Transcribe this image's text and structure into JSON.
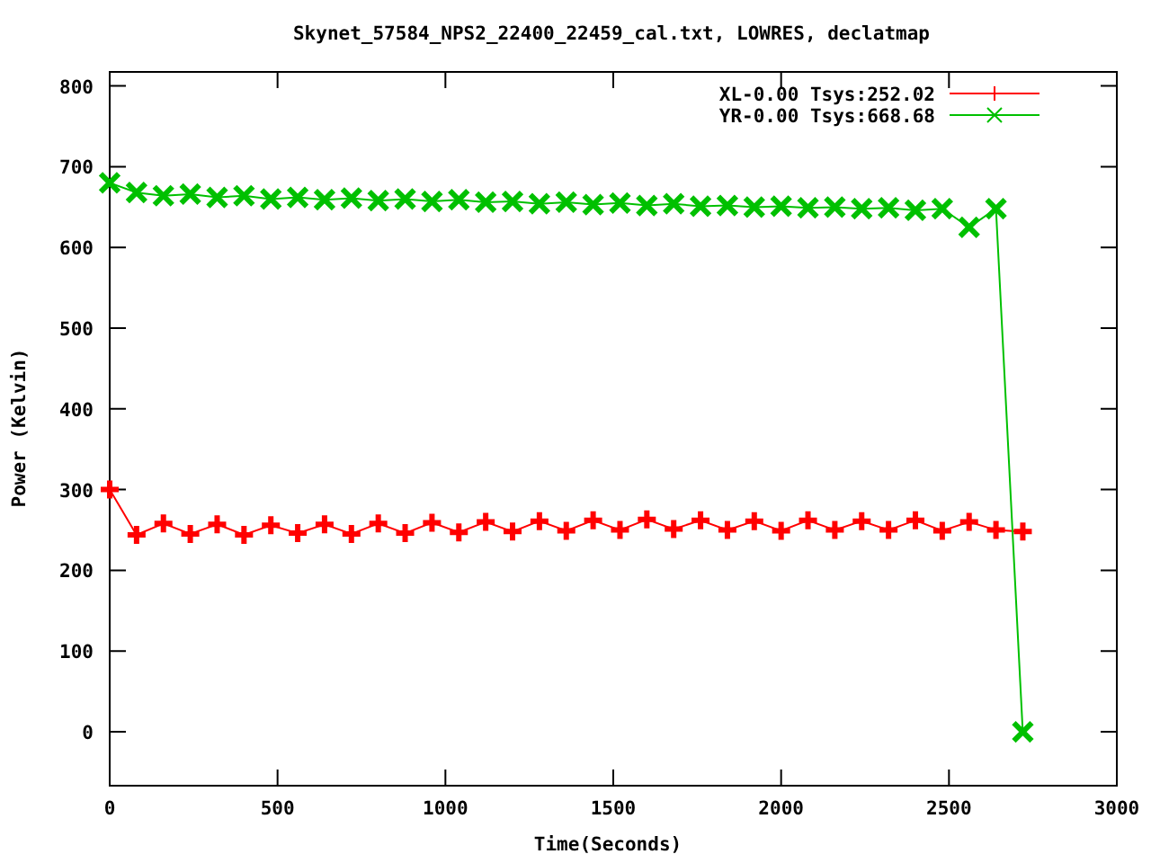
{
  "chart": {
    "chart_data": {
      "type": "line",
      "title": "Skynet_57584_NPS2_22400_22459_cal.txt, LOWRES, declatmap",
      "xlabel": "Time(Seconds)",
      "ylabel": "Power (Kelvin)",
      "x": [
        0,
        80,
        160,
        240,
        320,
        400,
        480,
        560,
        640,
        720,
        800,
        880,
        960,
        1040,
        1120,
        1200,
        1280,
        1360,
        1440,
        1520,
        1600,
        1680,
        1760,
        1840,
        1920,
        2000,
        2080,
        2160,
        2240,
        2320,
        2400,
        2480,
        2560,
        2640,
        2720
      ],
      "series": [
        {
          "name": "XL-0.00 Tsys:252.02",
          "color": "#ff0000",
          "marker": "plus",
          "values": [
            300,
            244,
            258,
            245,
            257,
            244,
            256,
            246,
            257,
            245,
            258,
            246,
            259,
            247,
            260,
            248,
            261,
            249,
            262,
            250,
            263,
            251,
            262,
            250,
            261,
            249,
            262,
            250,
            261,
            250,
            262,
            249,
            260,
            250,
            248
          ]
        },
        {
          "name": "YR-0.00 Tsys:668.68",
          "color": "#00c000",
          "marker": "cross",
          "values": [
            680,
            668,
            664,
            666,
            662,
            664,
            660,
            662,
            659,
            661,
            658,
            660,
            657,
            659,
            656,
            657,
            654,
            656,
            653,
            655,
            652,
            654,
            651,
            652,
            650,
            651,
            649,
            650,
            648,
            649,
            646,
            648,
            625,
            648,
            0
          ]
        }
      ],
      "legend": true,
      "xlim": [
        0,
        3000
      ],
      "ylim": [
        -66.8,
        817.4
      ],
      "xticks": [
        0,
        500,
        1000,
        1500,
        2000,
        2500,
        3000
      ],
      "yticks": [
        0,
        100,
        200,
        300,
        400,
        500,
        600,
        700,
        800
      ]
    }
  }
}
